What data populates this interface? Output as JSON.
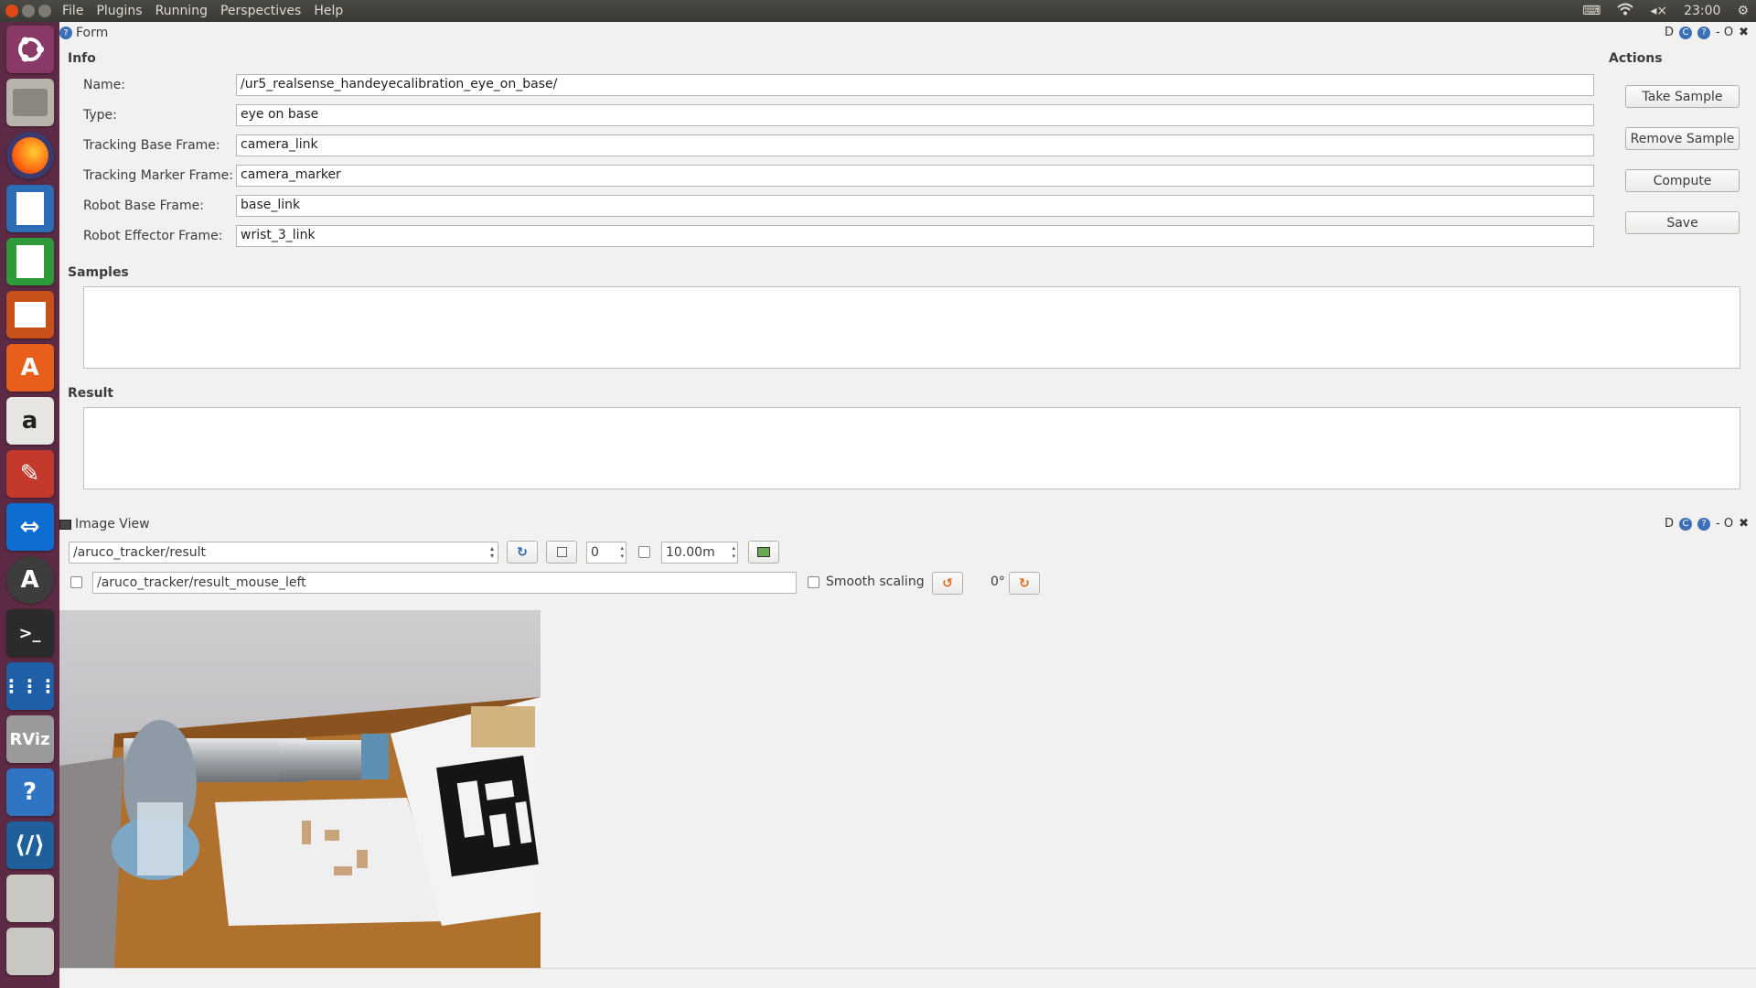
{
  "topbar": {
    "menu": [
      "File",
      "Plugins",
      "Running",
      "Perspectives",
      "Help"
    ],
    "time": "23:00"
  },
  "launcher": {
    "icons": [
      "ubuntu-dash-icon",
      "files-icon",
      "firefox-icon",
      "writer-icon",
      "calc-icon",
      "impress-icon",
      "software-center-icon",
      "amazon-icon",
      "settings-icon",
      "teamviewer-icon",
      "software-updater-icon",
      "terminal-icon",
      "app-grid-icon",
      "rviz-icon",
      "help-icon",
      "vscode-icon",
      "disk-icon",
      "disk2-icon"
    ]
  },
  "form": {
    "title": "Form",
    "info_label": "Info",
    "fields": [
      {
        "label": "Name:",
        "value": "/ur5_realsense_handeyecalibration_eye_on_base/"
      },
      {
        "label": "Type:",
        "value": "eye on base"
      },
      {
        "label": "Tracking Base Frame:",
        "value": "camera_link"
      },
      {
        "label": "Tracking Marker Frame:",
        "value": "camera_marker"
      },
      {
        "label": "Robot Base Frame:",
        "value": "base_link"
      },
      {
        "label": "Robot Effector Frame:",
        "value": "wrist_3_link"
      }
    ],
    "samples_label": "Samples",
    "result_label": "Result",
    "actions_label": "Actions",
    "actions": [
      "Take Sample",
      "Remove Sample",
      "Compute",
      "Save"
    ],
    "panel_ctl": [
      "D",
      "- O"
    ]
  },
  "image_view": {
    "title": "Image View",
    "topic": "/aruco_tracker/result",
    "spin_value": "0",
    "max_range": "10.00m",
    "mouse_topic": "/aruco_tracker/result_mouse_left",
    "smooth_scaling": "Smooth scaling",
    "rotation": "0°",
    "panel_ctl": [
      "D",
      "- O"
    ]
  },
  "colors": {
    "launcher_bg": "#5c2a44",
    "topbar_bg": "#3b3a36",
    "panel_bg": "#f2f1f0"
  }
}
